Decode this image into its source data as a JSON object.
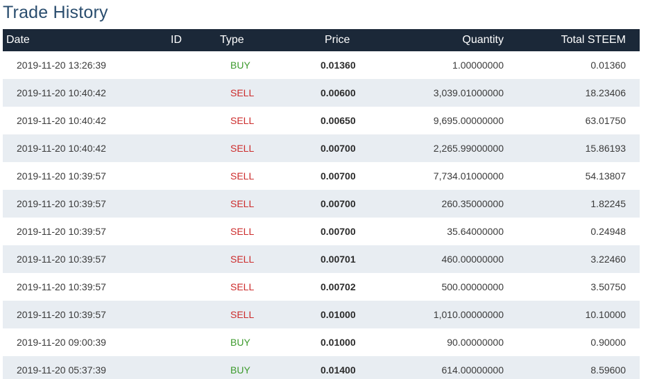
{
  "title": "Trade History",
  "columns": {
    "date": "Date",
    "id": "ID",
    "type": "Type",
    "price": "Price",
    "quantity": "Quantity",
    "total": "Total STEEM"
  },
  "colors": {
    "header_bg": "#1b2838",
    "title": "#2a4d6e",
    "buy": "#3c9a2c",
    "sell": "#cc2b2b",
    "row_alt": "#e8edf2"
  },
  "rows": [
    {
      "date": "2019-11-20 13:26:39",
      "id": "",
      "type": "BUY",
      "price": "0.01360",
      "quantity": "1.00000000",
      "total": "0.01360"
    },
    {
      "date": "2019-11-20 10:40:42",
      "id": "",
      "type": "SELL",
      "price": "0.00600",
      "quantity": "3,039.01000000",
      "total": "18.23406"
    },
    {
      "date": "2019-11-20 10:40:42",
      "id": "",
      "type": "SELL",
      "price": "0.00650",
      "quantity": "9,695.00000000",
      "total": "63.01750"
    },
    {
      "date": "2019-11-20 10:40:42",
      "id": "",
      "type": "SELL",
      "price": "0.00700",
      "quantity": "2,265.99000000",
      "total": "15.86193"
    },
    {
      "date": "2019-11-20 10:39:57",
      "id": "",
      "type": "SELL",
      "price": "0.00700",
      "quantity": "7,734.01000000",
      "total": "54.13807"
    },
    {
      "date": "2019-11-20 10:39:57",
      "id": "",
      "type": "SELL",
      "price": "0.00700",
      "quantity": "260.35000000",
      "total": "1.82245"
    },
    {
      "date": "2019-11-20 10:39:57",
      "id": "",
      "type": "SELL",
      "price": "0.00700",
      "quantity": "35.64000000",
      "total": "0.24948"
    },
    {
      "date": "2019-11-20 10:39:57",
      "id": "",
      "type": "SELL",
      "price": "0.00701",
      "quantity": "460.00000000",
      "total": "3.22460"
    },
    {
      "date": "2019-11-20 10:39:57",
      "id": "",
      "type": "SELL",
      "price": "0.00702",
      "quantity": "500.00000000",
      "total": "3.50750"
    },
    {
      "date": "2019-11-20 10:39:57",
      "id": "",
      "type": "SELL",
      "price": "0.01000",
      "quantity": "1,010.00000000",
      "total": "10.10000"
    },
    {
      "date": "2019-11-20 09:00:39",
      "id": "",
      "type": "BUY",
      "price": "0.01000",
      "quantity": "90.00000000",
      "total": "0.90000"
    },
    {
      "date": "2019-11-20 05:37:39",
      "id": "",
      "type": "BUY",
      "price": "0.01400",
      "quantity": "614.00000000",
      "total": "8.59600"
    }
  ]
}
